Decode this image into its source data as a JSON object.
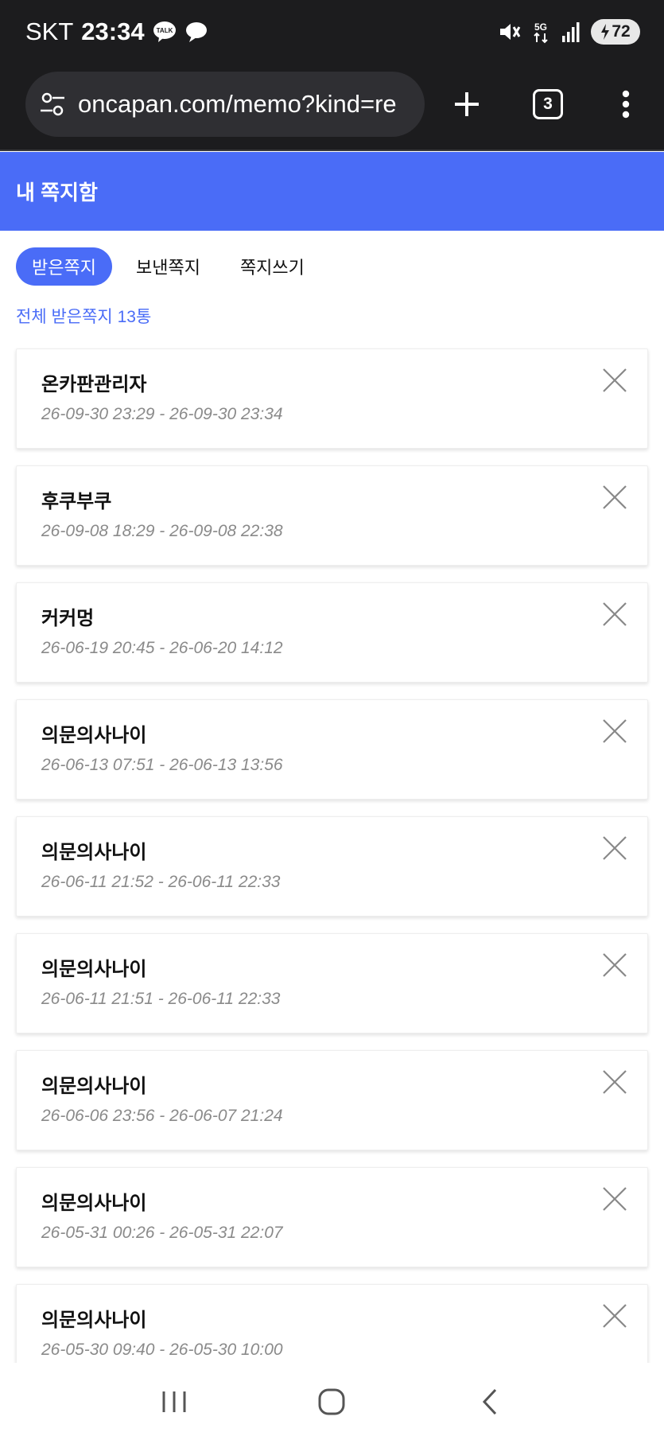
{
  "status_bar": {
    "carrier": "SKT",
    "time": "23:34",
    "notif_talk_label": "TALK",
    "network": "5G",
    "battery_level": "72"
  },
  "browser": {
    "url": "oncapan.com/memo?kind=re",
    "tab_count": "3"
  },
  "header": {
    "title": "내 쪽지함"
  },
  "tabs": [
    {
      "label": "받은쪽지",
      "active": true
    },
    {
      "label": "보낸쪽지",
      "active": false
    },
    {
      "label": "쪽지쓰기",
      "active": false
    }
  ],
  "summary": "전체 받은쪽지 13통",
  "memos": [
    {
      "sender": "온카판관리자",
      "date": "26-09-30 23:29 - 26-09-30 23:34"
    },
    {
      "sender": "후쿠부쿠",
      "date": "26-09-08 18:29 - 26-09-08 22:38"
    },
    {
      "sender": "커커멍",
      "date": "26-06-19 20:45 - 26-06-20 14:12"
    },
    {
      "sender": "의문의사나이",
      "date": "26-06-13 07:51 - 26-06-13 13:56"
    },
    {
      "sender": "의문의사나이",
      "date": "26-06-11 21:52 - 26-06-11 22:33"
    },
    {
      "sender": "의문의사나이",
      "date": "26-06-11 21:51 - 26-06-11 22:33"
    },
    {
      "sender": "의문의사나이",
      "date": "26-06-06 23:56 - 26-06-07 21:24"
    },
    {
      "sender": "의문의사나이",
      "date": "26-05-31 00:26 - 26-05-31 22:07"
    },
    {
      "sender": "의문의사나이",
      "date": "26-05-30 09:40 - 26-05-30 10:00"
    }
  ],
  "icons": {
    "delete": "close-icon",
    "nav_recent": "recent-apps-icon",
    "nav_home": "home-icon",
    "nav_back": "back-icon"
  },
  "colors": {
    "accent": "#4a6cf7",
    "status_bar_bg": "#1c1c1e",
    "date_text": "#8a8a8a"
  }
}
